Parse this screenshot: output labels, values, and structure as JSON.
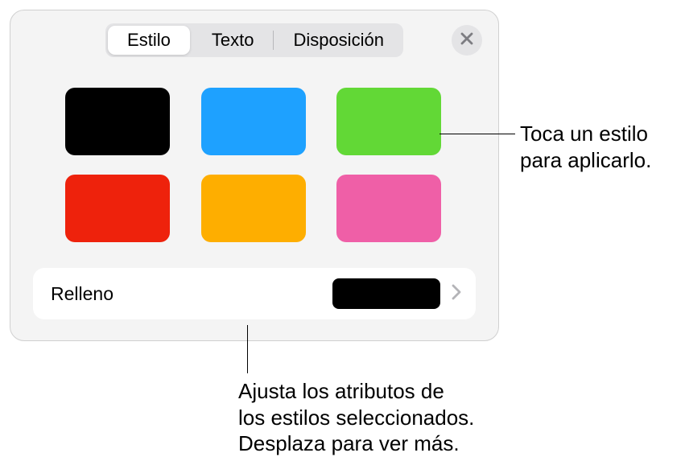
{
  "tabs": {
    "style": "Estilo",
    "text": "Texto",
    "layout": "Disposición"
  },
  "swatches": [
    {
      "color": "#000000",
      "name": "black"
    },
    {
      "color": "#1ea1ff",
      "name": "blue"
    },
    {
      "color": "#62d836",
      "name": "green"
    },
    {
      "color": "#ee220c",
      "name": "red"
    },
    {
      "color": "#feae00",
      "name": "orange"
    },
    {
      "color": "#ef5fa7",
      "name": "pink"
    }
  ],
  "fill": {
    "label": "Relleno",
    "preview_color": "#000000"
  },
  "callouts": {
    "top_line1": "Toca un estilo",
    "top_line2": "para aplicarlo.",
    "bottom_line1": "Ajusta los atributos de",
    "bottom_line2": "los estilos seleccionados.",
    "bottom_line3": "Desplaza para ver más."
  }
}
